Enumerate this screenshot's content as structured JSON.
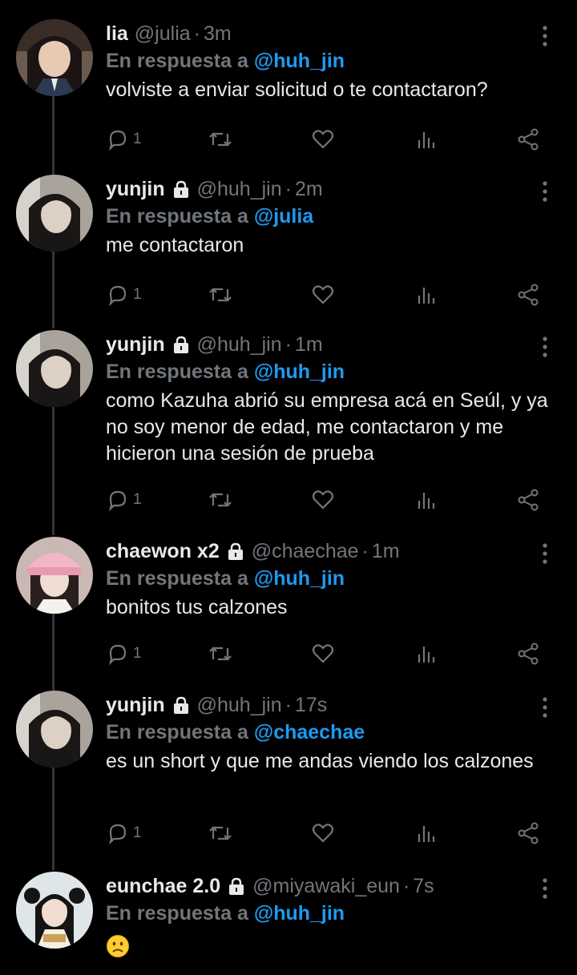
{
  "labels": {
    "replying_to": "En respuesta a",
    "dot": "·"
  },
  "colors": {
    "background": "#000000",
    "text": "#e7e9ea",
    "muted": "#71767b",
    "link": "#1d9bf0",
    "thread_line": "#333639"
  },
  "tweets": [
    {
      "name": "lia",
      "locked": false,
      "handle": "@julia",
      "time": "3m",
      "reply_to": "@huh_jin",
      "text": "volviste a enviar solicitud o te contactaron?",
      "reply_count": "1",
      "avatar_icon": "avatar-girl-icon"
    },
    {
      "name": "yunjin",
      "locked": true,
      "handle": "@huh_jin",
      "time": "2m",
      "reply_to": "@julia",
      "text": "me contactaron",
      "reply_count": "1",
      "avatar_icon": "avatar-dark-hair-icon"
    },
    {
      "name": "yunjin",
      "locked": true,
      "handle": "@huh_jin",
      "time": "1m",
      "reply_to": "@huh_jin",
      "text": "como Kazuha abrió su empresa acá en Seúl, y ya no soy menor de edad, me contactaron y me hicieron una sesión de prueba",
      "reply_count": "1",
      "avatar_icon": "avatar-dark-hair-icon"
    },
    {
      "name": "chaewon x2",
      "locked": true,
      "handle": "@chaechae",
      "time": "1m",
      "reply_to": "@huh_jin",
      "text": "bonitos tus calzones",
      "reply_count": "1",
      "avatar_icon": "avatar-pink-hat-icon"
    },
    {
      "name": "yunjin",
      "locked": true,
      "handle": "@huh_jin",
      "time": "17s",
      "reply_to": "@chaechae",
      "text": "es un short y que me andas viendo los calzones",
      "reply_count": "1",
      "avatar_icon": "avatar-dark-hair-icon"
    },
    {
      "name": "eunchae 2.0",
      "locked": true,
      "handle": "@miyawaki_eun",
      "time": "7s",
      "reply_to": "@huh_jin",
      "text": "",
      "emoji": "frowning-face-emoji",
      "reply_count": "",
      "avatar_icon": "avatar-twintails-icon"
    }
  ]
}
